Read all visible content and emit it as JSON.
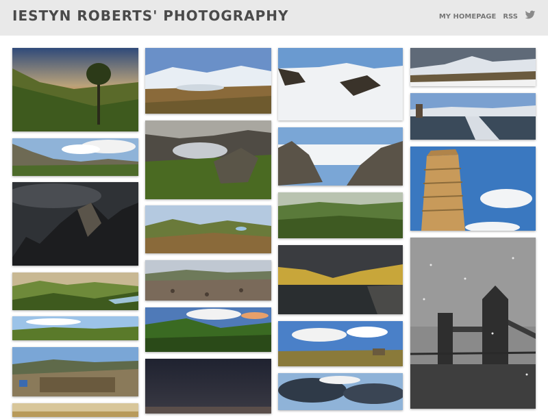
{
  "site": {
    "title": "IESTYN ROBERTS' PHOTOGRAPHY"
  },
  "nav": {
    "homepage_label": "MY HOMEPAGE",
    "rss_label": "RSS",
    "twitter_icon": "twitter-bird-icon"
  },
  "colors": {
    "header_bg": "#e9e9e9",
    "title": "#4a4a4a",
    "nav": "#777777"
  },
  "photos": [
    {
      "name": "photo-hillside-tree-sunset",
      "column": 1
    },
    {
      "name": "photo-mountain-ridge-clouds",
      "column": 1
    },
    {
      "name": "photo-dark-dolomite-peaks",
      "column": 1
    },
    {
      "name": "photo-green-valley-river",
      "column": 1
    },
    {
      "name": "photo-wide-green-plain",
      "column": 1
    },
    {
      "name": "photo-rock-quarry-hikers",
      "column": 1
    },
    {
      "name": "photo-golden-horizon",
      "column": 1
    },
    {
      "name": "photo-snowy-valley-lake",
      "column": 2
    },
    {
      "name": "photo-lake-hills-boulder",
      "column": 2
    },
    {
      "name": "photo-green-hills-dusk",
      "column": 2
    },
    {
      "name": "photo-rocky-summit-panorama",
      "column": 2
    },
    {
      "name": "photo-green-hills-sunset-clouds",
      "column": 2
    },
    {
      "name": "photo-dark-dusk-sky",
      "column": 2
    },
    {
      "name": "photo-snowy-summit-tracks",
      "column": 3
    },
    {
      "name": "photo-rocky-peaks-cloud-sea",
      "column": 3
    },
    {
      "name": "photo-hazy-green-valley",
      "column": 3
    },
    {
      "name": "photo-lake-pier-golden-hills",
      "column": 3
    },
    {
      "name": "photo-moorland-blue-sky",
      "column": 3
    },
    {
      "name": "photo-dramatic-clouds",
      "column": 3
    },
    {
      "name": "photo-snowy-mountain-panorama",
      "column": 4
    },
    {
      "name": "photo-frozen-lake-boardwalk",
      "column": 4
    },
    {
      "name": "photo-leaning-tower-pisa",
      "column": 4
    },
    {
      "name": "photo-tower-bridge-snow",
      "column": 4
    }
  ]
}
